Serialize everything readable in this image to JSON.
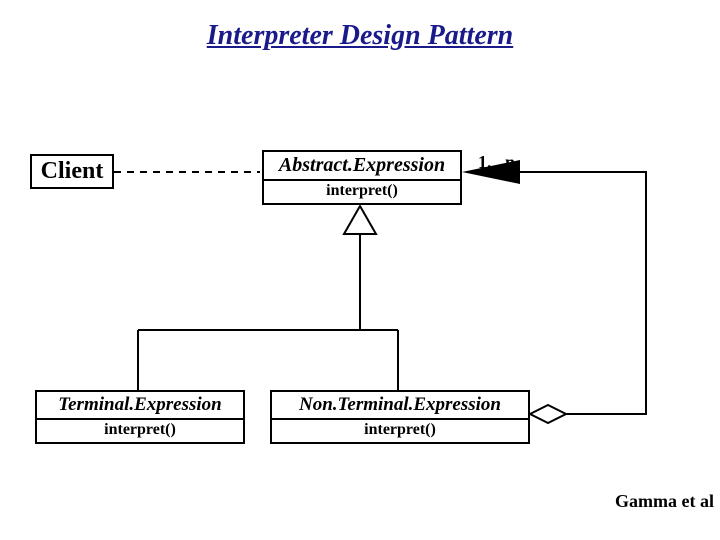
{
  "title": "Interpreter Design Pattern",
  "client": {
    "name": "Client"
  },
  "abstract": {
    "name": "Abstract.Expression",
    "method": "interpret()"
  },
  "terminal": {
    "name": "Terminal.Expression",
    "method": "interpret()"
  },
  "nonterminal": {
    "name": "Non.Terminal.Expression",
    "method": "interpret()"
  },
  "multiplicity": "1. . n",
  "credit": "Gamma et al"
}
